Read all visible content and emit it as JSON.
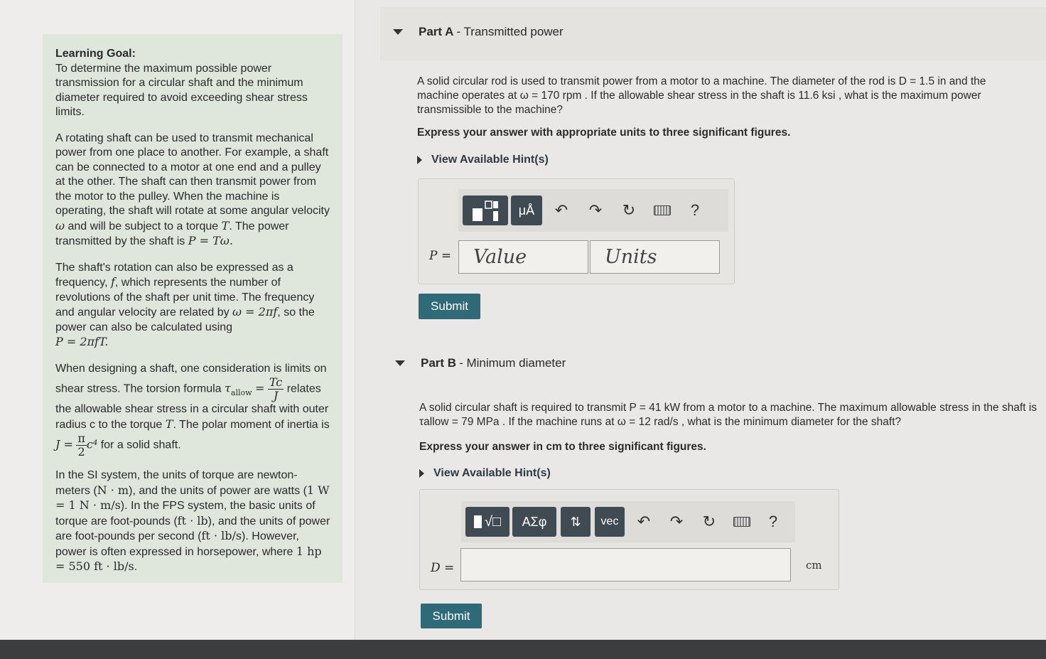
{
  "learning_goal": {
    "title": "Learning Goal:",
    "intro": "To determine the maximum possible power transmission for a circular shaft and the minimum diameter required to avoid exceeding shear stress limits.",
    "p1_text": "A rotating shaft can be used to transmit mechanical power from one place to another. For example, a shaft can be connected to a motor at one end and a pulley at the other. The shaft can then transmit power from the motor to the pulley. When the machine is operating, the shaft will rotate at some angular velocity",
    "p1_omega": "ω",
    "p1_mid": "and will be subject to a torque",
    "p1_T": "T",
    "p1_end": ". The power transmitted by the shaft is",
    "p1_formula": "P = Tω.",
    "p2_text": "The shaft's rotation can also be expressed as a frequency,",
    "p2_f": "f",
    "p2_mid": ", which represents the number of revolutions of the shaft per unit time. The frequency and angular velocity are related by",
    "p2_rel": "ω = 2πf",
    "p2_end": ", so the power can also be calculated using",
    "p2_formula": "P = 2πfT.",
    "p3_text": "When designing a shaft, one consideration is limits on shear stress. The torsion formula",
    "p3_tau": "τ",
    "p3_sub": "allow",
    "p3_eq": "=",
    "p3_num": "Tc",
    "p3_den": "J",
    "p3_mid": "relates the allowable shear stress in a circular shaft with outer radius c to the torque",
    "p3_T": "T",
    "p3_mid2": ". The polar moment of inertia is",
    "p3_J": "J =",
    "p3_pi": "π",
    "p3_two": "2",
    "p3_c4": "c⁴",
    "p3_end": "for a solid shaft.",
    "p4_a": "In the SI system, the units of torque are newton-meters (",
    "p4_nm": "N · m",
    "p4_b": "), and the units of power are watts (",
    "p4_w": "1 W = 1 N · m/s",
    "p4_c": "). In the FPS system, the basic units of torque are foot-pounds (",
    "p4_ftlb": "ft · lb",
    "p4_d": "), and the units of power are foot-pounds per second (",
    "p4_ftlbs": "ft · lb/s",
    "p4_e": "). However, power is often expressed in horsepower, where",
    "p4_hp": "1 hp = 550 ft · lb/s",
    "p4_f": "."
  },
  "part_a": {
    "letter": "Part A",
    "title": "- Transmitted power",
    "question": "A solid circular rod is used to transmit power from a motor to a machine. The diameter of the rod is D = 1.5 in and the machine operates at ω = 170 rpm . If the allowable shear stress in the shaft is 11.6 ksi , what is the maximum power transmissible to the machine?",
    "instruction": "Express your answer with appropriate units to three significant figures.",
    "hint": "View Available Hint(s)",
    "toolbar": {
      "templates_icon": "templates-icon",
      "units_label": "μÅ",
      "undo": "↶",
      "redo": "↷",
      "reset": "↻",
      "help": "?"
    },
    "var_label": "P =",
    "value_placeholder": "Value",
    "units_placeholder": "Units",
    "submit": "Submit"
  },
  "part_b": {
    "letter": "Part B",
    "title": "- Minimum diameter",
    "question": "A solid circular shaft is required to transmit P = 41 kW from a motor to a machine. The maximum allowable stress in the shaft is τallow = 79 MPa . If the machine runs at ω = 12 rad/s , what is the minimum diameter for the shaft?",
    "instruction": "Express your answer in cm to three significant figures.",
    "hint": "View Available Hint(s)",
    "toolbar": {
      "templates_label": "√□",
      "greek_label": "ΑΣφ",
      "arrows_label": "⇅",
      "vec_label": "vec",
      "undo": "↶",
      "redo": "↷",
      "reset": "↻",
      "help": "?"
    },
    "var_label": "D =",
    "value": "",
    "unit": "cm",
    "submit": "Submit"
  },
  "colors": {
    "submit_bg": "#2f6a79",
    "tool_button_bg": "#3f4a52",
    "goal_box_bg": "#dfe6dc"
  }
}
